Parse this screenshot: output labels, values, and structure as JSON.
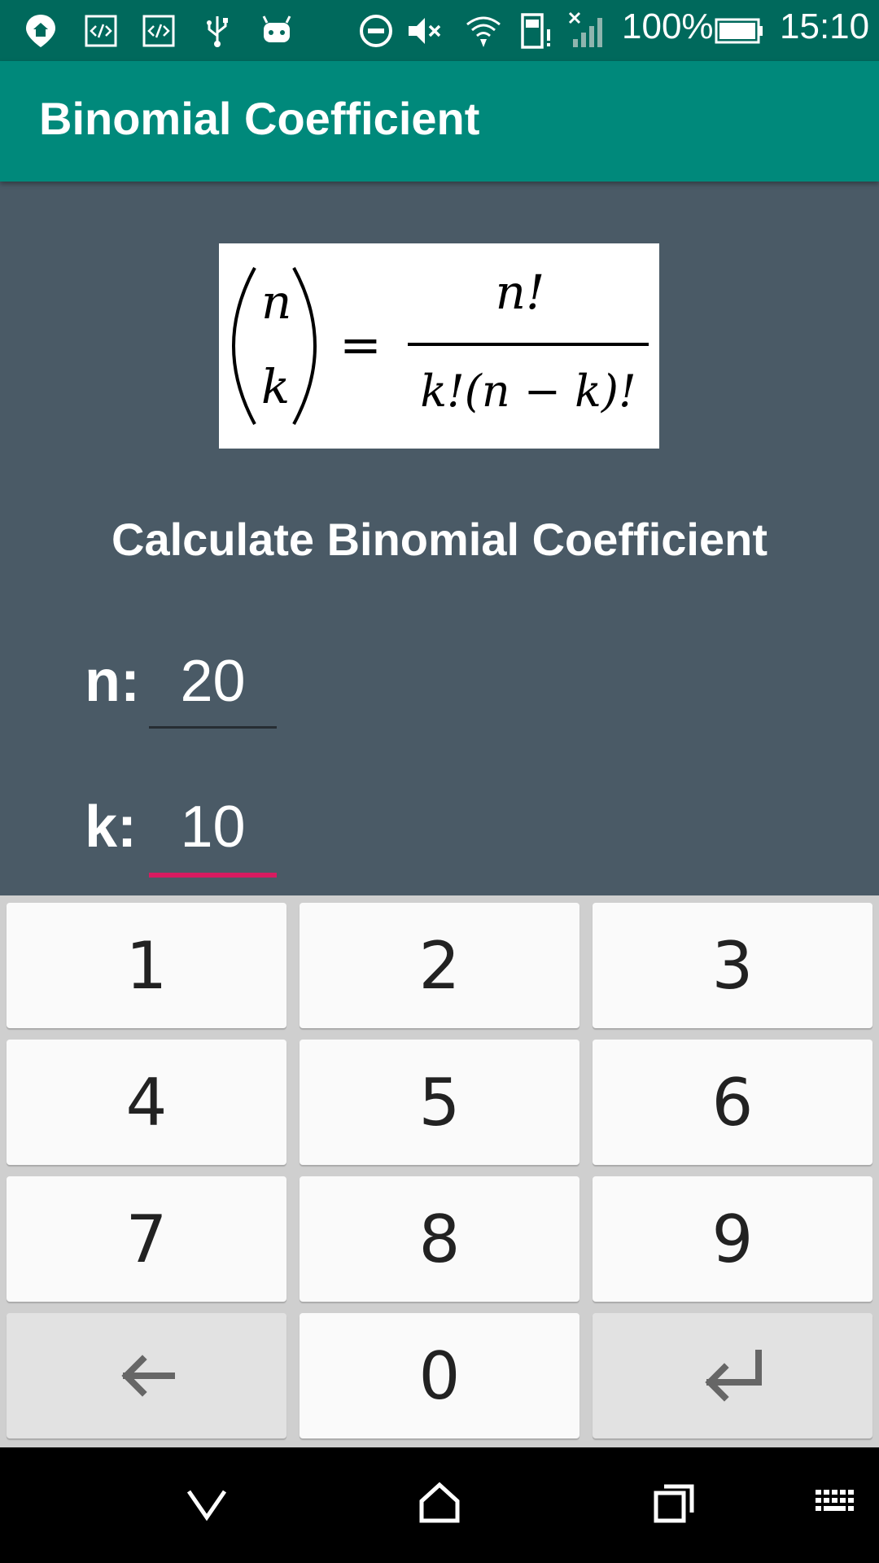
{
  "status_bar": {
    "battery": "100%",
    "time": "15:10",
    "icons": [
      "location-icon",
      "code-icon",
      "code-icon",
      "usb-icon",
      "android-icon",
      "do-not-disturb-icon",
      "mute-icon",
      "wifi-icon",
      "sim-alert-icon",
      "signal-icon",
      "battery-icon"
    ]
  },
  "app_bar": {
    "title": "Binomial Coefficient"
  },
  "formula": {
    "lhs_top": "n",
    "lhs_bottom": "k",
    "equals": "=",
    "numerator": "n!",
    "denominator": "k!(n − k)!"
  },
  "main": {
    "heading": "Calculate Binomial Coefficient",
    "n_label": "n:",
    "n_value": "20",
    "k_label": "k:",
    "k_value": "10"
  },
  "keyboard": {
    "keys": [
      "1",
      "2",
      "3",
      "4",
      "5",
      "6",
      "7",
      "8",
      "9",
      "0"
    ],
    "backspace_icon": "backspace-arrow-icon",
    "enter_icon": "enter-icon"
  },
  "colors": {
    "status_bar": "#00695c",
    "app_bar": "#00897b",
    "background": "#4a5a66",
    "accent": "#d81b60"
  },
  "nav_bar": {
    "icons": [
      "hide-keyboard-icon",
      "home-icon",
      "recents-icon",
      "keyboard-switch-icon"
    ]
  }
}
